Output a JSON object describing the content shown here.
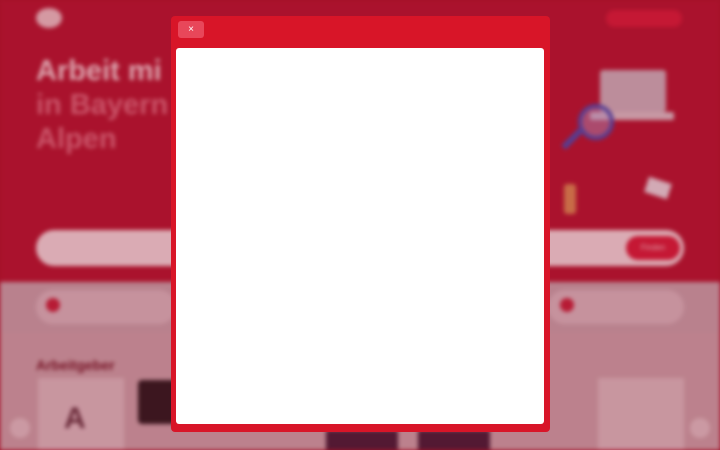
{
  "hero": {
    "headline": [
      "Arbeit mi",
      "in Bayern",
      "Alpen"
    ]
  },
  "search": {
    "button_label": "Finden"
  },
  "employers": {
    "title": "Arbeitgeber"
  },
  "modal": {
    "close_label": "×"
  },
  "colors": {
    "brand_red": "#d81528",
    "modal_body": "#ffffff",
    "close_button": "#e8475a"
  },
  "icons": [
    "close-icon",
    "magnifier-icon",
    "laptop-icon"
  ]
}
